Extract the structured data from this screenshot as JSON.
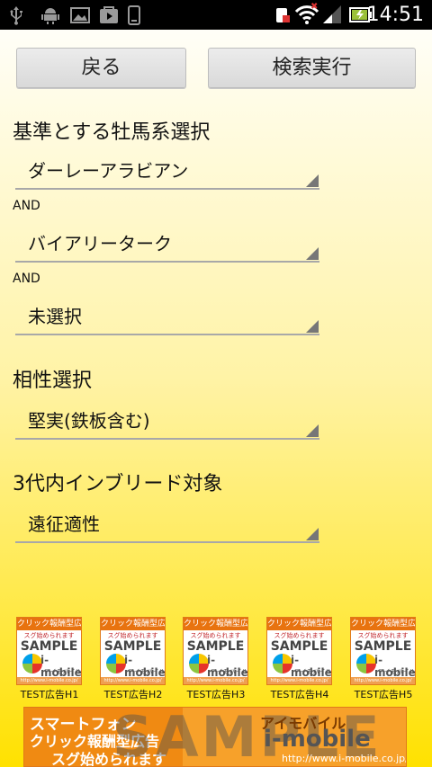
{
  "status_bar": {
    "time": "14:51",
    "left_icons": [
      "usb-icon",
      "android-icon",
      "image-icon",
      "play-store-icon",
      "phone-icon"
    ],
    "right_icons": [
      "sim-alert-icon",
      "wifi-icon",
      "signal-icon",
      "battery-charging-icon"
    ]
  },
  "toolbar": {
    "back_label": "戻る",
    "search_label": "検索実行"
  },
  "stallion_section": {
    "title": "基準とする牡馬系選択",
    "spinner1": "ダーレーアラビアン",
    "and1": "AND",
    "spinner2": "バイアリーターク",
    "and2": "AND",
    "spinner3": "未選択"
  },
  "compat_section": {
    "title": "相性選択",
    "spinner": "堅実(鉄板含む)"
  },
  "inbreed_section": {
    "title": "3代内インブリード対象",
    "spinner": "遠征適性"
  },
  "ads": {
    "icon_header": "クリック報酬型広告",
    "icon_sub": "スグ始められます",
    "icon_sample": "SAMPLE",
    "icon_brand": "i-mobile",
    "icon_kana": "アイモバイル",
    "icon_url": "http://www.i-mobile.co.jp/",
    "captions": [
      "TEST広告H1",
      "TEST広告H2",
      "TEST広告H3",
      "TEST広告H4",
      "TEST広告H5"
    ],
    "banner": {
      "line1": "スマートフォン",
      "line2": "クリック報酬型広告",
      "line3": "スグ始められます",
      "watermark": "SAMPLE",
      "brand_kana": "アイモバイル",
      "brand": "i-mobile",
      "url": "http://www.i-mobile.co.jp/"
    }
  }
}
